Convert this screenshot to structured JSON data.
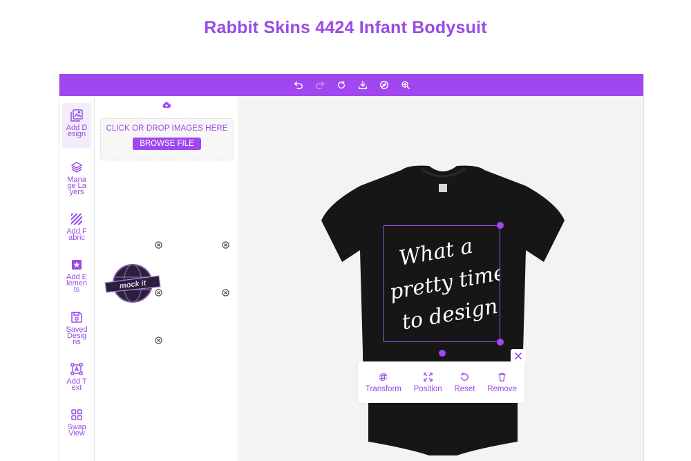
{
  "page": {
    "title": "Rabbit Skins 4424 Infant Bodysuit"
  },
  "colors": {
    "accent": "#a147ef",
    "accent_text": "#9a4ae6",
    "garment": "#161616",
    "canvas_bg": "#f3f3f3"
  },
  "toolbar": {
    "icons": [
      "undo-icon",
      "redo-icon",
      "refresh-icon",
      "download-icon",
      "compass-icon",
      "zoom-in-icon"
    ]
  },
  "sidebar": {
    "items": [
      {
        "icon": "add-design-icon",
        "label": "Add Design",
        "active": true
      },
      {
        "icon": "layers-icon",
        "label": "Manage Layers"
      },
      {
        "icon": "fabric-icon",
        "label": "Add Fabric"
      },
      {
        "icon": "star-box-icon",
        "label": "Add Elements"
      },
      {
        "icon": "save-icon",
        "label": "Saved Designs"
      },
      {
        "icon": "text-box-icon",
        "label": "Add Text"
      },
      {
        "icon": "grid-icon",
        "label": "Swap View"
      }
    ]
  },
  "panel": {
    "dropzone_text": "CLICK OR DROP IMAGES HERE",
    "browse_label": "BROWSE FILE",
    "logo_text": "mock it"
  },
  "design": {
    "lines": [
      "What a",
      "pretty time",
      "to design"
    ]
  },
  "popup": {
    "transform_label": "Transform",
    "position_label": "Position",
    "reset_label": "Reset",
    "remove_label": "Remove"
  }
}
